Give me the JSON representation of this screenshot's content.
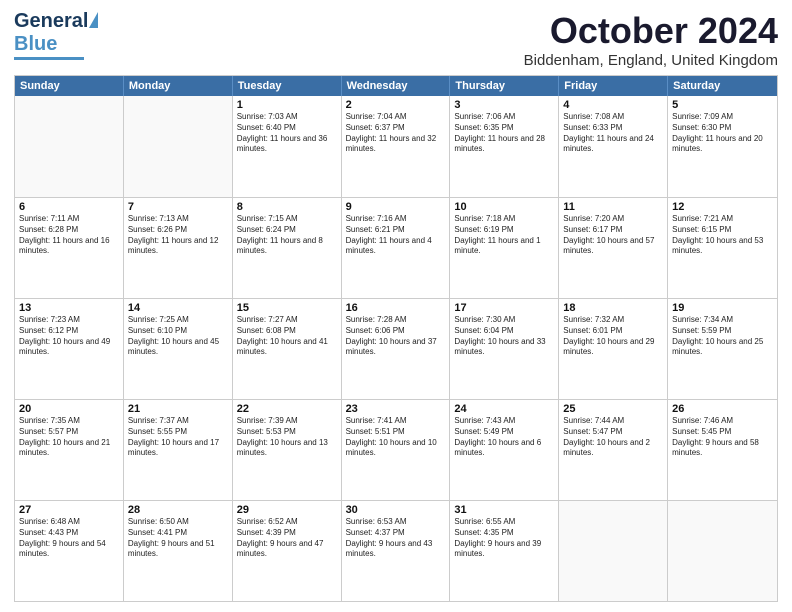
{
  "logo": {
    "line1": "General",
    "line2": "Blue"
  },
  "header": {
    "month": "October 2024",
    "location": "Biddenham, England, United Kingdom"
  },
  "days": [
    "Sunday",
    "Monday",
    "Tuesday",
    "Wednesday",
    "Thursday",
    "Friday",
    "Saturday"
  ],
  "weeks": [
    [
      {
        "num": "",
        "sunrise": "",
        "sunset": "",
        "daylight": ""
      },
      {
        "num": "",
        "sunrise": "",
        "sunset": "",
        "daylight": ""
      },
      {
        "num": "1",
        "sunrise": "Sunrise: 7:03 AM",
        "sunset": "Sunset: 6:40 PM",
        "daylight": "Daylight: 11 hours and 36 minutes."
      },
      {
        "num": "2",
        "sunrise": "Sunrise: 7:04 AM",
        "sunset": "Sunset: 6:37 PM",
        "daylight": "Daylight: 11 hours and 32 minutes."
      },
      {
        "num": "3",
        "sunrise": "Sunrise: 7:06 AM",
        "sunset": "Sunset: 6:35 PM",
        "daylight": "Daylight: 11 hours and 28 minutes."
      },
      {
        "num": "4",
        "sunrise": "Sunrise: 7:08 AM",
        "sunset": "Sunset: 6:33 PM",
        "daylight": "Daylight: 11 hours and 24 minutes."
      },
      {
        "num": "5",
        "sunrise": "Sunrise: 7:09 AM",
        "sunset": "Sunset: 6:30 PM",
        "daylight": "Daylight: 11 hours and 20 minutes."
      }
    ],
    [
      {
        "num": "6",
        "sunrise": "Sunrise: 7:11 AM",
        "sunset": "Sunset: 6:28 PM",
        "daylight": "Daylight: 11 hours and 16 minutes."
      },
      {
        "num": "7",
        "sunrise": "Sunrise: 7:13 AM",
        "sunset": "Sunset: 6:26 PM",
        "daylight": "Daylight: 11 hours and 12 minutes."
      },
      {
        "num": "8",
        "sunrise": "Sunrise: 7:15 AM",
        "sunset": "Sunset: 6:24 PM",
        "daylight": "Daylight: 11 hours and 8 minutes."
      },
      {
        "num": "9",
        "sunrise": "Sunrise: 7:16 AM",
        "sunset": "Sunset: 6:21 PM",
        "daylight": "Daylight: 11 hours and 4 minutes."
      },
      {
        "num": "10",
        "sunrise": "Sunrise: 7:18 AM",
        "sunset": "Sunset: 6:19 PM",
        "daylight": "Daylight: 11 hours and 1 minute."
      },
      {
        "num": "11",
        "sunrise": "Sunrise: 7:20 AM",
        "sunset": "Sunset: 6:17 PM",
        "daylight": "Daylight: 10 hours and 57 minutes."
      },
      {
        "num": "12",
        "sunrise": "Sunrise: 7:21 AM",
        "sunset": "Sunset: 6:15 PM",
        "daylight": "Daylight: 10 hours and 53 minutes."
      }
    ],
    [
      {
        "num": "13",
        "sunrise": "Sunrise: 7:23 AM",
        "sunset": "Sunset: 6:12 PM",
        "daylight": "Daylight: 10 hours and 49 minutes."
      },
      {
        "num": "14",
        "sunrise": "Sunrise: 7:25 AM",
        "sunset": "Sunset: 6:10 PM",
        "daylight": "Daylight: 10 hours and 45 minutes."
      },
      {
        "num": "15",
        "sunrise": "Sunrise: 7:27 AM",
        "sunset": "Sunset: 6:08 PM",
        "daylight": "Daylight: 10 hours and 41 minutes."
      },
      {
        "num": "16",
        "sunrise": "Sunrise: 7:28 AM",
        "sunset": "Sunset: 6:06 PM",
        "daylight": "Daylight: 10 hours and 37 minutes."
      },
      {
        "num": "17",
        "sunrise": "Sunrise: 7:30 AM",
        "sunset": "Sunset: 6:04 PM",
        "daylight": "Daylight: 10 hours and 33 minutes."
      },
      {
        "num": "18",
        "sunrise": "Sunrise: 7:32 AM",
        "sunset": "Sunset: 6:01 PM",
        "daylight": "Daylight: 10 hours and 29 minutes."
      },
      {
        "num": "19",
        "sunrise": "Sunrise: 7:34 AM",
        "sunset": "Sunset: 5:59 PM",
        "daylight": "Daylight: 10 hours and 25 minutes."
      }
    ],
    [
      {
        "num": "20",
        "sunrise": "Sunrise: 7:35 AM",
        "sunset": "Sunset: 5:57 PM",
        "daylight": "Daylight: 10 hours and 21 minutes."
      },
      {
        "num": "21",
        "sunrise": "Sunrise: 7:37 AM",
        "sunset": "Sunset: 5:55 PM",
        "daylight": "Daylight: 10 hours and 17 minutes."
      },
      {
        "num": "22",
        "sunrise": "Sunrise: 7:39 AM",
        "sunset": "Sunset: 5:53 PM",
        "daylight": "Daylight: 10 hours and 13 minutes."
      },
      {
        "num": "23",
        "sunrise": "Sunrise: 7:41 AM",
        "sunset": "Sunset: 5:51 PM",
        "daylight": "Daylight: 10 hours and 10 minutes."
      },
      {
        "num": "24",
        "sunrise": "Sunrise: 7:43 AM",
        "sunset": "Sunset: 5:49 PM",
        "daylight": "Daylight: 10 hours and 6 minutes."
      },
      {
        "num": "25",
        "sunrise": "Sunrise: 7:44 AM",
        "sunset": "Sunset: 5:47 PM",
        "daylight": "Daylight: 10 hours and 2 minutes."
      },
      {
        "num": "26",
        "sunrise": "Sunrise: 7:46 AM",
        "sunset": "Sunset: 5:45 PM",
        "daylight": "Daylight: 9 hours and 58 minutes."
      }
    ],
    [
      {
        "num": "27",
        "sunrise": "Sunrise: 6:48 AM",
        "sunset": "Sunset: 4:43 PM",
        "daylight": "Daylight: 9 hours and 54 minutes."
      },
      {
        "num": "28",
        "sunrise": "Sunrise: 6:50 AM",
        "sunset": "Sunset: 4:41 PM",
        "daylight": "Daylight: 9 hours and 51 minutes."
      },
      {
        "num": "29",
        "sunrise": "Sunrise: 6:52 AM",
        "sunset": "Sunset: 4:39 PM",
        "daylight": "Daylight: 9 hours and 47 minutes."
      },
      {
        "num": "30",
        "sunrise": "Sunrise: 6:53 AM",
        "sunset": "Sunset: 4:37 PM",
        "daylight": "Daylight: 9 hours and 43 minutes."
      },
      {
        "num": "31",
        "sunrise": "Sunrise: 6:55 AM",
        "sunset": "Sunset: 4:35 PM",
        "daylight": "Daylight: 9 hours and 39 minutes."
      },
      {
        "num": "",
        "sunrise": "",
        "sunset": "",
        "daylight": ""
      },
      {
        "num": "",
        "sunrise": "",
        "sunset": "",
        "daylight": ""
      }
    ]
  ]
}
